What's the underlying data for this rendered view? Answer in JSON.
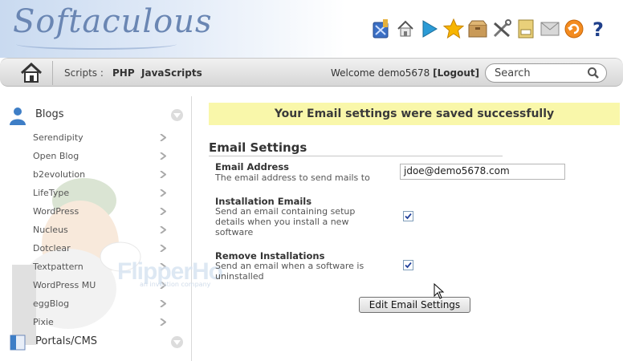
{
  "header": {
    "logo": "Softaculous",
    "icons": [
      "scripts-icon",
      "home-icon",
      "play-icon",
      "star-icon",
      "box-icon",
      "tools-icon",
      "backup-icon",
      "email-icon",
      "update-icon",
      "help-icon"
    ]
  },
  "nav": {
    "scripts_label": "Scripts :",
    "php_label": "PHP",
    "javascripts_label": "JavaScripts",
    "welcome_prefix": "Welcome demo5678",
    "logout_label": "[Logout]",
    "search_placeholder": "Search"
  },
  "sidebar": {
    "categories": [
      {
        "label": "Blogs",
        "items": [
          "Serendipity",
          "Open Blog",
          "b2evolution",
          "LifeType",
          "WordPress",
          "Nucleus",
          "Dotclear",
          "Textpattern",
          "WordPress MU",
          "eggBlog",
          "Pixie"
        ]
      },
      {
        "label": "Portals/CMS",
        "items": []
      }
    ]
  },
  "main": {
    "success_message": "Your Email settings were saved successfully",
    "section_title": "Email Settings",
    "fields": {
      "email_address": {
        "label": "Email Address",
        "description": "The email address to send mails to",
        "value": "jdoe@demo5678.com"
      },
      "installation_emails": {
        "label": "Installation Emails",
        "description": "Send an email containing setup details when you install a new software",
        "checked": true
      },
      "remove_installations": {
        "label": "Remove Installations",
        "description": "Send an email when a software is uninstalled",
        "checked": true
      }
    },
    "submit_label": "Edit Email Settings"
  },
  "watermark": {
    "text": "FlipperHo",
    "sub": "an investion company"
  },
  "colors": {
    "success_bg": "#f9f7aa",
    "logo": "#6a86b3",
    "nav_bg": "#dcdcdc"
  }
}
